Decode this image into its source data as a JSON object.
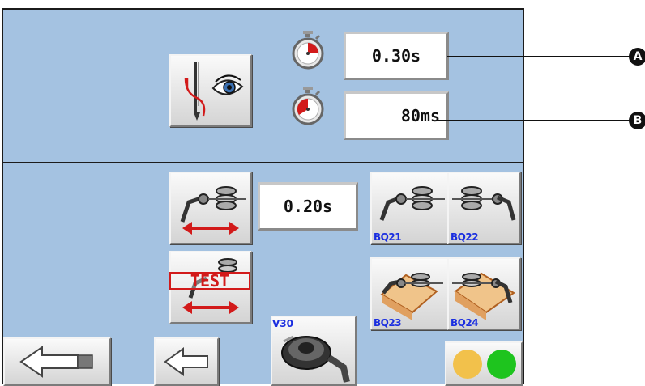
{
  "timers": {
    "timer_a_value": "0.30s",
    "timer_b_value": "80ms"
  },
  "thread_timer": {
    "value": "0.20s"
  },
  "buttons": {
    "bq21_label": "BQ21",
    "bq22_label": "BQ22",
    "bq23_label": "BQ23",
    "bq24_label": "BQ24",
    "test_label": "TEST",
    "v30_label": "V30"
  },
  "callouts": {
    "a": "A",
    "b": "B"
  },
  "icons": {
    "needle_eye": "needle-eye-icon",
    "stopwatch": "stopwatch-icon",
    "thread_tension": "thread-tension-icon",
    "bobbin_case": "bobbin-case-icon",
    "back_arrow": "arrow-left-icon"
  },
  "colors": {
    "panel": "#a4c2e1",
    "label_blue": "#1a2ee0",
    "red_accent": "#d21a1a",
    "status_yellow": "#f2c14b",
    "status_green": "#1ec41e"
  }
}
